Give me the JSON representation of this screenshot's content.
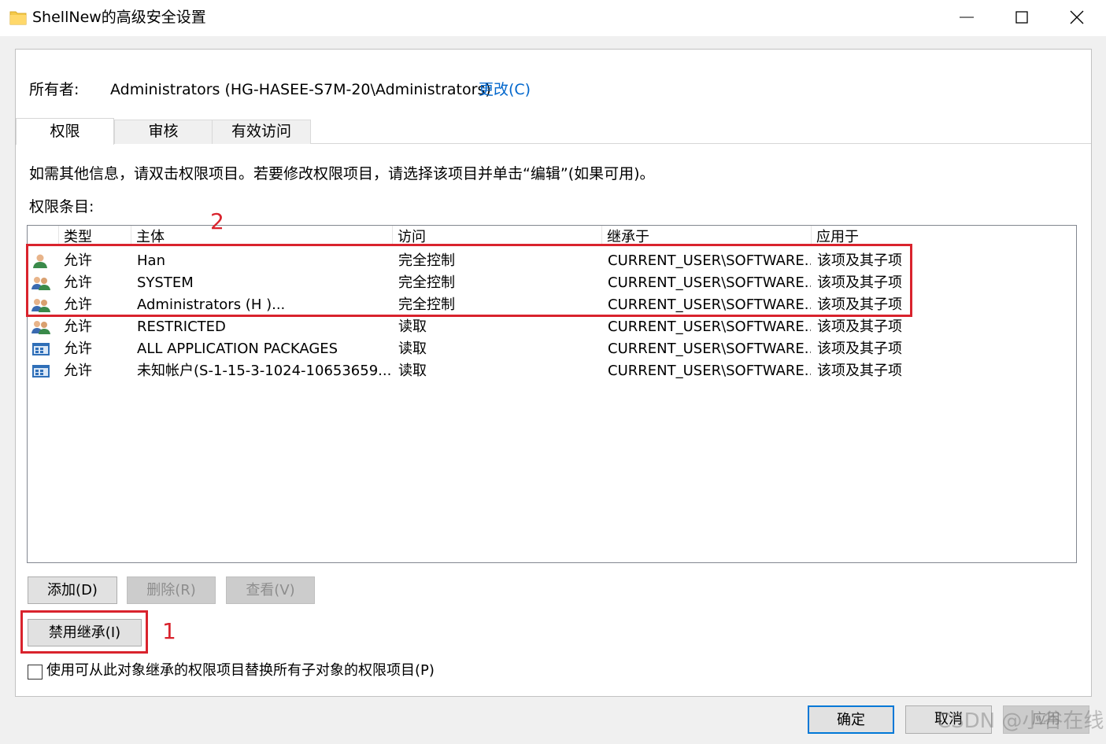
{
  "window": {
    "title": "ShellNew的高级安全设置",
    "minimize_icon": "minimize-icon",
    "maximize_icon": "maximize-icon",
    "close_icon": "close-icon"
  },
  "owner": {
    "label": "所有者:",
    "value": "Administrators (HG-HASEE-S7M-20\\Administrators)",
    "change_link": "更改(C)"
  },
  "tabs": [
    {
      "label": "权限",
      "active": true
    },
    {
      "label": "审核",
      "active": false
    },
    {
      "label": "有效访问",
      "active": false
    }
  ],
  "info_text": "如需其他信息，请双击权限项目。若要修改权限项目，请选择该项目并单击“编辑”(如果可用)。",
  "entries_label": "权限条目:",
  "columns": [
    "类型",
    "主体",
    "访问",
    "继承于",
    "应用于"
  ],
  "rows": [
    {
      "icon": "user-icon",
      "type": "允许",
      "principal": "Han",
      "access": "完全控制",
      "inherited_from": "CURRENT_USER\\SOFTWARE...",
      "applies_to": "该项及其子项"
    },
    {
      "icon": "group-icon",
      "type": "允许",
      "principal": "SYSTEM",
      "access": "完全控制",
      "inherited_from": "CURRENT_USER\\SOFTWARE...",
      "applies_to": "该项及其子项"
    },
    {
      "icon": "group-icon",
      "type": "允许",
      "principal": "Administrators (H                              )...",
      "access": "完全控制",
      "inherited_from": "CURRENT_USER\\SOFTWARE...",
      "applies_to": "该项及其子项"
    },
    {
      "icon": "group-icon",
      "type": "允许",
      "principal": "RESTRICTED",
      "access": "读取",
      "inherited_from": "CURRENT_USER\\SOFTWARE...",
      "applies_to": "该项及其子项"
    },
    {
      "icon": "app-package-icon",
      "type": "允许",
      "principal": "ALL APPLICATION PACKAGES",
      "access": "读取",
      "inherited_from": "CURRENT_USER\\SOFTWARE...",
      "applies_to": "该项及其子项"
    },
    {
      "icon": "app-package-icon",
      "type": "允许",
      "principal": "未知帐户(S-1-15-3-1024-10653659...",
      "access": "读取",
      "inherited_from": "CURRENT_USER\\SOFTWARE...",
      "applies_to": "该项及其子项"
    }
  ],
  "annotations": {
    "one": "1",
    "two": "2",
    "color": "#d9232d"
  },
  "buttons": {
    "add": "添加(D)",
    "remove": "删除(R)",
    "view": "查看(V)",
    "disable_inheritance": "禁用继承(I)",
    "ok": "确定",
    "cancel": "取消",
    "apply": "应用"
  },
  "replace_checkbox": {
    "label": "使用可从此对象继承的权限项目替换所有子对象的权限项目(P)",
    "checked": false
  },
  "watermark": "CSDN @小谷在线",
  "colors": {
    "accent": "#0078d7",
    "link": "#0066cc"
  }
}
